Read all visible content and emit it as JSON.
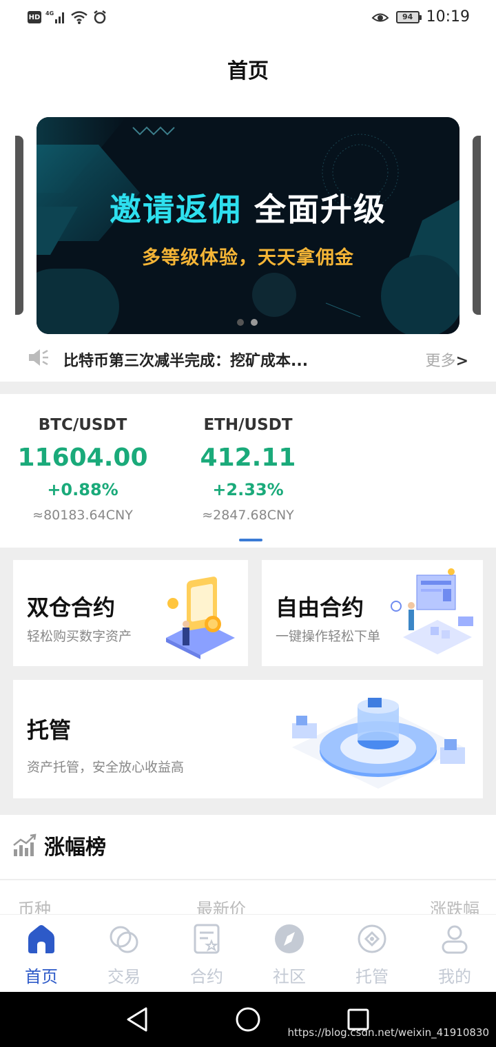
{
  "status_bar": {
    "hd": "HD",
    "network": "4G",
    "battery": "94",
    "time": "10:19"
  },
  "header": {
    "title": "首页"
  },
  "banner": {
    "title_highlight": "邀请返佣",
    "title_rest": " 全面升级",
    "subtitle": "多等级体验，天天拿佣金",
    "page_count": 2,
    "active_page": 2
  },
  "ticker": {
    "text": "比特币第三次减半完成：挖矿成本...",
    "more": "更多",
    "more_arrow": ">"
  },
  "prices": [
    {
      "pair": "BTC/USDT",
      "price": "11604.00",
      "change": "+0.88%",
      "cny": "≈80183.64CNY"
    },
    {
      "pair": "ETH/USDT",
      "price": "412.11",
      "change": "+2.33%",
      "cny": "≈2847.68CNY"
    }
  ],
  "cards": {
    "dual": {
      "title": "双仓合约",
      "subtitle": "轻松购买数字资产"
    },
    "free": {
      "title": "自由合约",
      "subtitle": "一键操作轻松下单"
    },
    "custody": {
      "title": "托管",
      "subtitle": "资产托管，安全放心收益高"
    }
  },
  "ranking": {
    "title": "涨幅榜",
    "columns": [
      "币种",
      "最新价",
      "涨跌幅"
    ]
  },
  "bottom_nav": [
    {
      "label": "首页",
      "icon": "home-icon",
      "active": true
    },
    {
      "label": "交易",
      "icon": "trade-icon",
      "active": false
    },
    {
      "label": "合约",
      "icon": "contract-icon",
      "active": false
    },
    {
      "label": "社区",
      "icon": "compass-icon",
      "active": false
    },
    {
      "label": "托管",
      "icon": "custody-icon",
      "active": false
    },
    {
      "label": "我的",
      "icon": "profile-icon",
      "active": false
    }
  ],
  "colors": {
    "up": "#1aaa7a",
    "accent": "#2d5ac8",
    "banner_highlight": "#2ee0ef",
    "banner_subtitle": "#f5b536"
  },
  "watermark": "https://blog.csdn.net/weixin_41910830"
}
